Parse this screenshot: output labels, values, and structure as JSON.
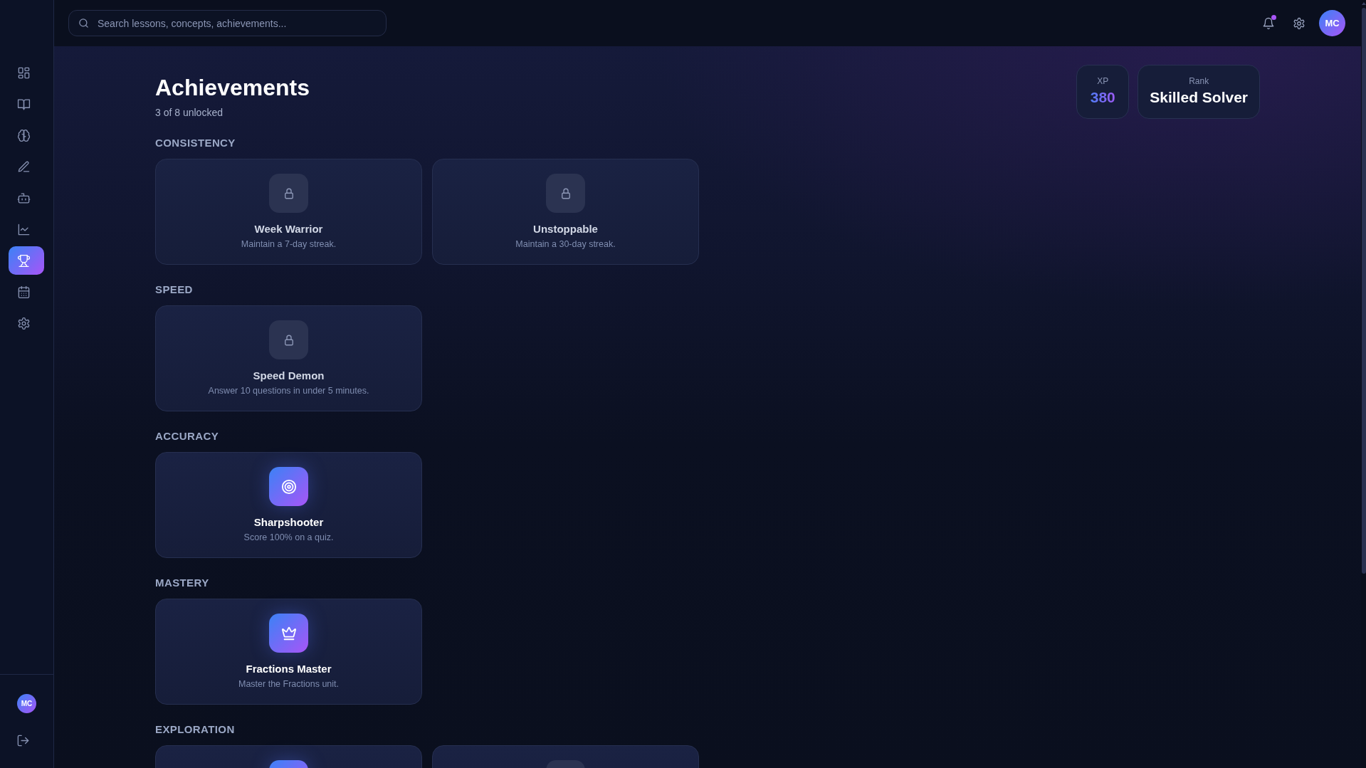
{
  "sidebar": {
    "items": [
      {
        "selected": false
      },
      {
        "selected": false
      },
      {
        "selected": false
      },
      {
        "selected": false
      },
      {
        "selected": false
      },
      {
        "selected": false
      },
      {
        "selected": true
      },
      {
        "selected": false
      },
      {
        "selected": false
      }
    ],
    "user": {
      "initials": "MC"
    }
  },
  "search": {
    "placeholder": "Search lessons, concepts, achievements..."
  },
  "top_bar": {
    "notifications": {
      "unread": true
    },
    "user": {
      "initials": "MC"
    }
  },
  "header": {
    "title": "Achievements",
    "subtitle": "3 of 8 unlocked"
  },
  "stats": [
    {
      "label": "XP",
      "value": "380",
      "kind": "accent"
    },
    {
      "label": "Rank",
      "value": "Skilled Solver",
      "kind": "plain"
    }
  ],
  "sections": [
    {
      "title": "CONSISTENCY",
      "achievements": [
        {
          "title": "Week Warrior",
          "description": "Maintain a 7-day streak.",
          "unlocked": false
        },
        {
          "title": "Unstoppable",
          "description": "Maintain a 30-day streak.",
          "unlocked": false
        }
      ]
    },
    {
      "title": "SPEED",
      "achievements": [
        {
          "title": "Speed Demon",
          "description": "Answer 10 questions in under 5 minutes.",
          "unlocked": false
        }
      ]
    },
    {
      "title": "ACCURACY",
      "achievements": [
        {
          "title": "Sharpshooter",
          "description": "Score 100% on a quiz.",
          "unlocked": true
        }
      ]
    },
    {
      "title": "MASTERY",
      "achievements": [
        {
          "title": "Fractions Master",
          "description": "Master the Fractions unit.",
          "unlocked": true
        }
      ]
    },
    {
      "title": "EXPLORATION",
      "achievements": [
        {
          "unlocked": true
        },
        {
          "unlocked": false
        }
      ]
    }
  ]
}
